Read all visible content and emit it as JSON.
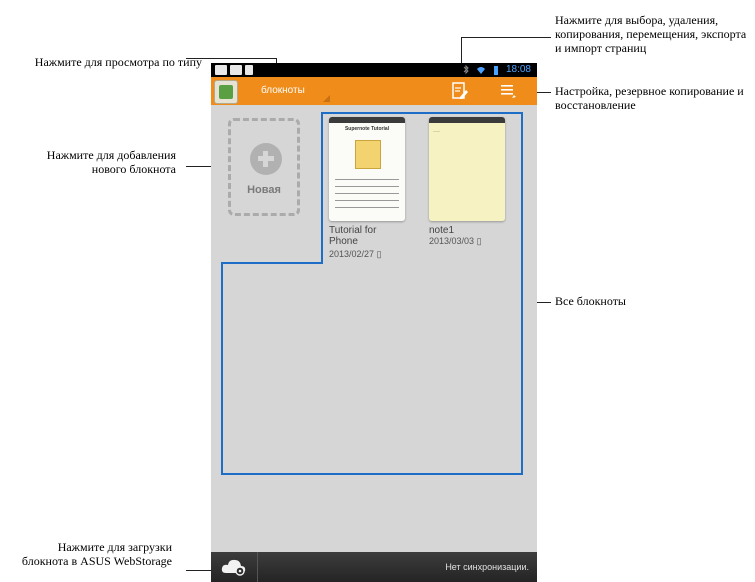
{
  "callouts": {
    "view_by_type": "Нажмите для просмотра по типу",
    "add_notebook": "Нажмите для добавления нового блокнота",
    "upload": "Нажмите для загрузки блокнота в ASUS WebStorage",
    "select_pages": "Нажмите для выбора, удаления, копирования, перемещения, экспорта и импорт страниц",
    "settings": "Настройка, резервное копирование и восстановление",
    "all_notebooks": "Все блокноты"
  },
  "status_bar": {
    "time": "18:08"
  },
  "action_bar": {
    "title": "блокноты"
  },
  "new_card": {
    "label": "Новая"
  },
  "notebooks": [
    {
      "name_line1": "Tutorial for",
      "name_line2": "Phone",
      "date": "2013/02/27",
      "cover_title": "Supernote Tutorial"
    },
    {
      "name_line1": "note1",
      "name_line2": "",
      "date": "2013/03/03"
    }
  ],
  "bottom_bar": {
    "sync_status": "Нет синхронизации."
  },
  "colors": {
    "action_bar": "#f08c1a",
    "accent_blue": "#1e6ec8",
    "screen_bg": "#d6d6d6"
  }
}
